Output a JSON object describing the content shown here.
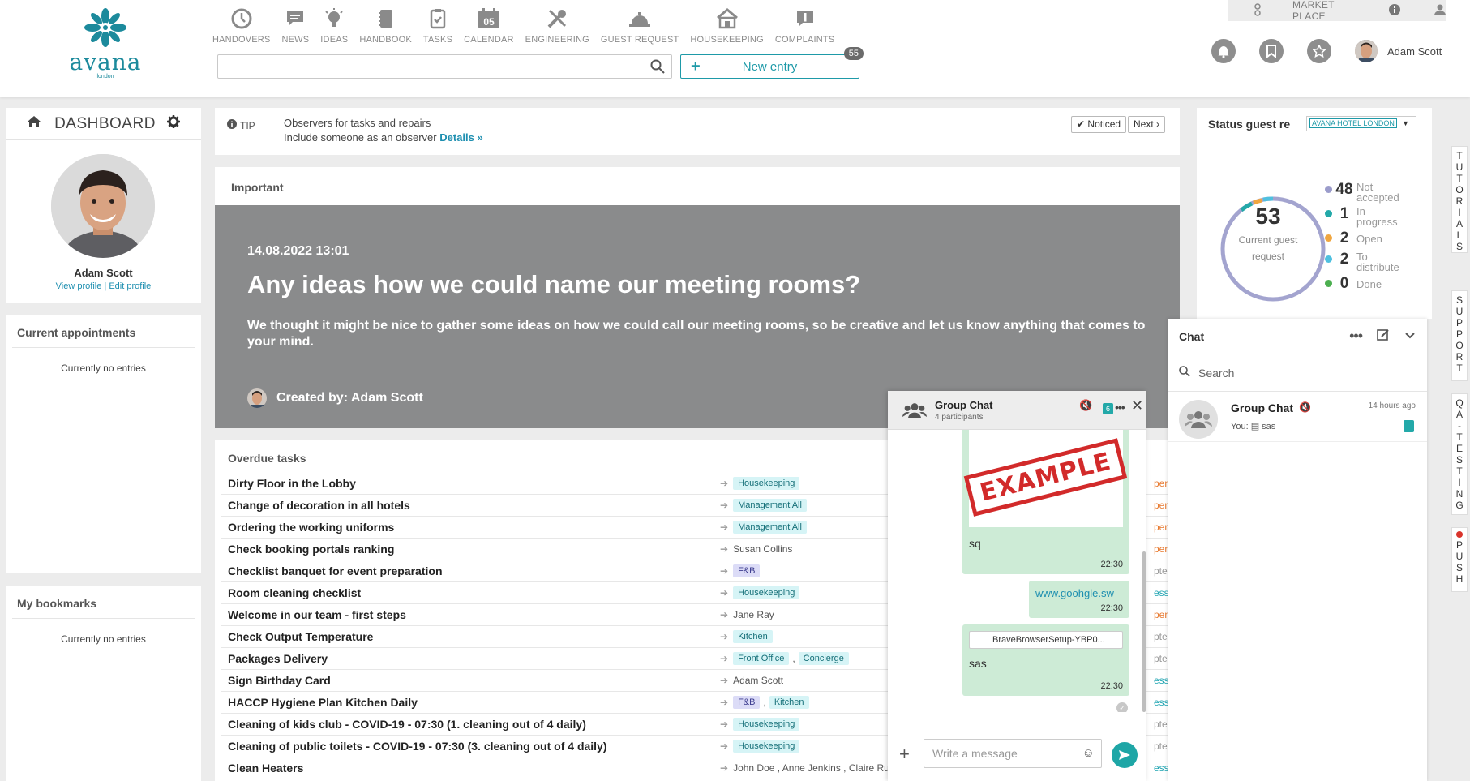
{
  "topbar": {
    "logo": {
      "word": "avana",
      "sub": "london"
    },
    "modules": [
      {
        "label": "HANDOVERS",
        "icon": "clock-icon"
      },
      {
        "label": "NEWS",
        "icon": "speech-bubble-icon"
      },
      {
        "label": "IDEAS",
        "icon": "lightbulb-icon"
      },
      {
        "label": "HANDBOOK",
        "icon": "notebook-icon"
      },
      {
        "label": "TASKS",
        "icon": "clipboard-check-icon"
      },
      {
        "label": "CALENDAR",
        "icon": "calendar-icon",
        "day": "05"
      },
      {
        "label": "ENGINEERING",
        "icon": "tools-icon"
      },
      {
        "label": "GUEST REQUEST",
        "icon": "service-bell-icon"
      },
      {
        "label": "HOUSEKEEPING",
        "icon": "house-icon"
      },
      {
        "label": "COMPLAINTS",
        "icon": "exclamation-bubble-icon"
      }
    ],
    "search": {
      "value": "",
      "placeholder": ""
    },
    "new_entry": {
      "label": "New entry",
      "count": "55"
    },
    "market_place": "MARKET PLACE",
    "user_name": "Adam Scott"
  },
  "dashboard": {
    "title": "DASHBOARD",
    "user_name": "Adam Scott",
    "view_profile": "View profile",
    "separator": "|",
    "edit_profile": "Edit profile"
  },
  "appointments": {
    "title": "Current appointments",
    "empty": "Currently no entries"
  },
  "bookmarks": {
    "title": "My bookmarks",
    "empty": "Currently no entries"
  },
  "tip": {
    "label": "TIP",
    "line1": "Observers for tasks and repairs",
    "line2": "Include someone as an observer",
    "details": "Details »",
    "noticed": "Noticed",
    "next": "Next"
  },
  "important": {
    "heading": "Important",
    "date": "14.08.2022 13:01",
    "title": "Any ideas how we could name our meeting rooms?",
    "body": "We thought it might be nice to gather some ideas on how we could call our meeting rooms, so be creative and let us know anything that comes to your mind.",
    "created_by": "Created by: Adam Scott"
  },
  "overdue": {
    "heading": "Overdue tasks",
    "tasks": [
      {
        "name": "Dirty Floor in the Lobby",
        "tags": [
          {
            "t": "Housekeeping",
            "c": "teal"
          }
        ],
        "status": "pen",
        "sc": "#e8792e"
      },
      {
        "name": "Change of decoration in all hotels",
        "tags": [
          {
            "t": "Management All",
            "c": "teal"
          }
        ],
        "status": "pen",
        "sc": "#e8792e"
      },
      {
        "name": "Ordering the working uniforms",
        "tags": [
          {
            "t": "Management All",
            "c": "teal"
          }
        ],
        "status": "pen",
        "sc": "#e8792e"
      },
      {
        "name": "Check booking portals ranking",
        "person": "Susan Collins",
        "status": "pen",
        "sc": "#e8792e"
      },
      {
        "name": "Checklist banquet for event preparation",
        "tags": [
          {
            "t": "F&B",
            "c": "purple"
          }
        ],
        "status": "pted",
        "sc": "#999"
      },
      {
        "name": "Room cleaning checklist",
        "tags": [
          {
            "t": "Housekeeping",
            "c": "teal"
          }
        ],
        "status": "ess",
        "sc": "#22a6b3"
      },
      {
        "name": "Welcome in our team - first steps",
        "person": "Jane Ray",
        "status": "pen",
        "sc": "#e8792e"
      },
      {
        "name": "Check Output Temperature",
        "tags": [
          {
            "t": "Kitchen",
            "c": "teal"
          }
        ],
        "status": "pted",
        "sc": "#999"
      },
      {
        "name": "Packages Delivery",
        "tags": [
          {
            "t": "Front Office",
            "c": "teal"
          },
          {
            "t": "Concierge",
            "c": "teal"
          }
        ],
        "status": "pted",
        "sc": "#999"
      },
      {
        "name": "Sign Birthday Card",
        "person": "Adam Scott",
        "status": "ess",
        "sc": "#22a6b3"
      },
      {
        "name": "HACCP Hygiene Plan Kitchen Daily",
        "tags": [
          {
            "t": "F&B",
            "c": "purple"
          },
          {
            "t": "Kitchen",
            "c": "teal"
          }
        ],
        "status": "ess",
        "sc": "#22a6b3"
      },
      {
        "name": "Cleaning of kids club - COVID-19 - 07:30 (1. cleaning out of 4 daily)",
        "tags": [
          {
            "t": "Housekeeping",
            "c": "teal"
          }
        ],
        "status": "pted",
        "sc": "#999"
      },
      {
        "name": "Cleaning of public toilets - COVID-19 - 07:30 (3. cleaning out of 4 daily)",
        "tags": [
          {
            "t": "Housekeeping",
            "c": "teal"
          }
        ],
        "status": "pted",
        "sc": "#999"
      },
      {
        "name": "Clean Heaters",
        "person": "John Doe , Anne Jenkins , Claire Ru",
        "status": "ess",
        "sc": "#22a6b3"
      }
    ]
  },
  "status_card": {
    "title": "Status guest re",
    "hotel": "AVANA HOTEL LONDON",
    "total": "53",
    "total_label": "Current guest request",
    "items": [
      {
        "n": "48",
        "l": "Not accepted",
        "color": "#9b9ccb"
      },
      {
        "n": "1",
        "l": "In progress",
        "color": "#23a9a9"
      },
      {
        "n": "2",
        "l": "Open",
        "color": "#f0a640"
      },
      {
        "n": "2",
        "l": "To distribute",
        "color": "#4fc0df"
      },
      {
        "n": "0",
        "l": "Done",
        "color": "#4caf50"
      }
    ]
  },
  "side_tabs": [
    {
      "label": "TUTORIALS"
    },
    {
      "label": "SUPPORT"
    },
    {
      "label": "QA-TESTING"
    },
    {
      "label": "PUSH"
    }
  ],
  "chat_list": {
    "title": "Chat",
    "search_placeholder": "Search",
    "item": {
      "name": "Group Chat",
      "time": "14 hours ago",
      "preview_prefix": "You:",
      "preview": "sas"
    }
  },
  "group_chat": {
    "title": "Group Chat",
    "participants": "4 participants",
    "unread": "6",
    "stamp": "EXAMPLE",
    "messages": [
      {
        "text": "sq",
        "time": "22:30"
      },
      {
        "text": "www.goohgle.sw",
        "time": "22:30"
      },
      {
        "file": "BraveBrowserSetup-YBP0...",
        "text": "sas",
        "time": "22:30"
      }
    ],
    "input_placeholder": "Write a message"
  }
}
